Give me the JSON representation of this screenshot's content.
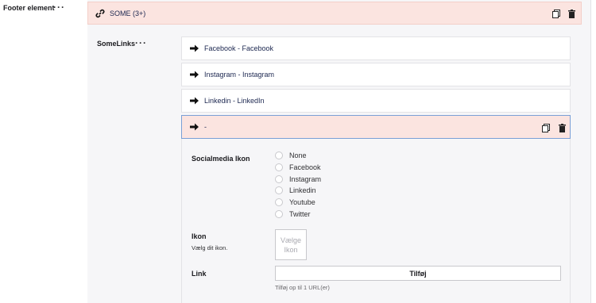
{
  "left_label": "Footer element",
  "left_menu_icon": "ellipsis-icon",
  "header_block": {
    "title": "SOME (3+)",
    "icon": "link-icon",
    "actions": [
      "copy-icon",
      "trash-icon"
    ]
  },
  "somelinks": {
    "label": "SomeLinks",
    "items": [
      {
        "text": "Facebook - Facebook"
      },
      {
        "text": "Instagram - Instagram"
      },
      {
        "text": "Linkedin - LinkedIn"
      }
    ],
    "active_item": {
      "text": "-"
    }
  },
  "form": {
    "socialmedia_label": "Socialmedia Ikon",
    "options": [
      "None",
      "Facebook",
      "Instagram",
      "Linkedin",
      "Youtube",
      "Twitter"
    ],
    "ikon_label": "Ikon",
    "ikon_desc": "Vælg dit ikon.",
    "ikon_button_line1": "Vælge",
    "ikon_button_line2": "Ikon",
    "link_label": "Link",
    "link_add": "Tilføj",
    "link_hint": "Tilføj op til 1 URL(er)"
  },
  "colors": {
    "header_bg": "#fbe4e0",
    "panel_bg": "#f6f6f8",
    "active_border": "#7a9fd6"
  }
}
